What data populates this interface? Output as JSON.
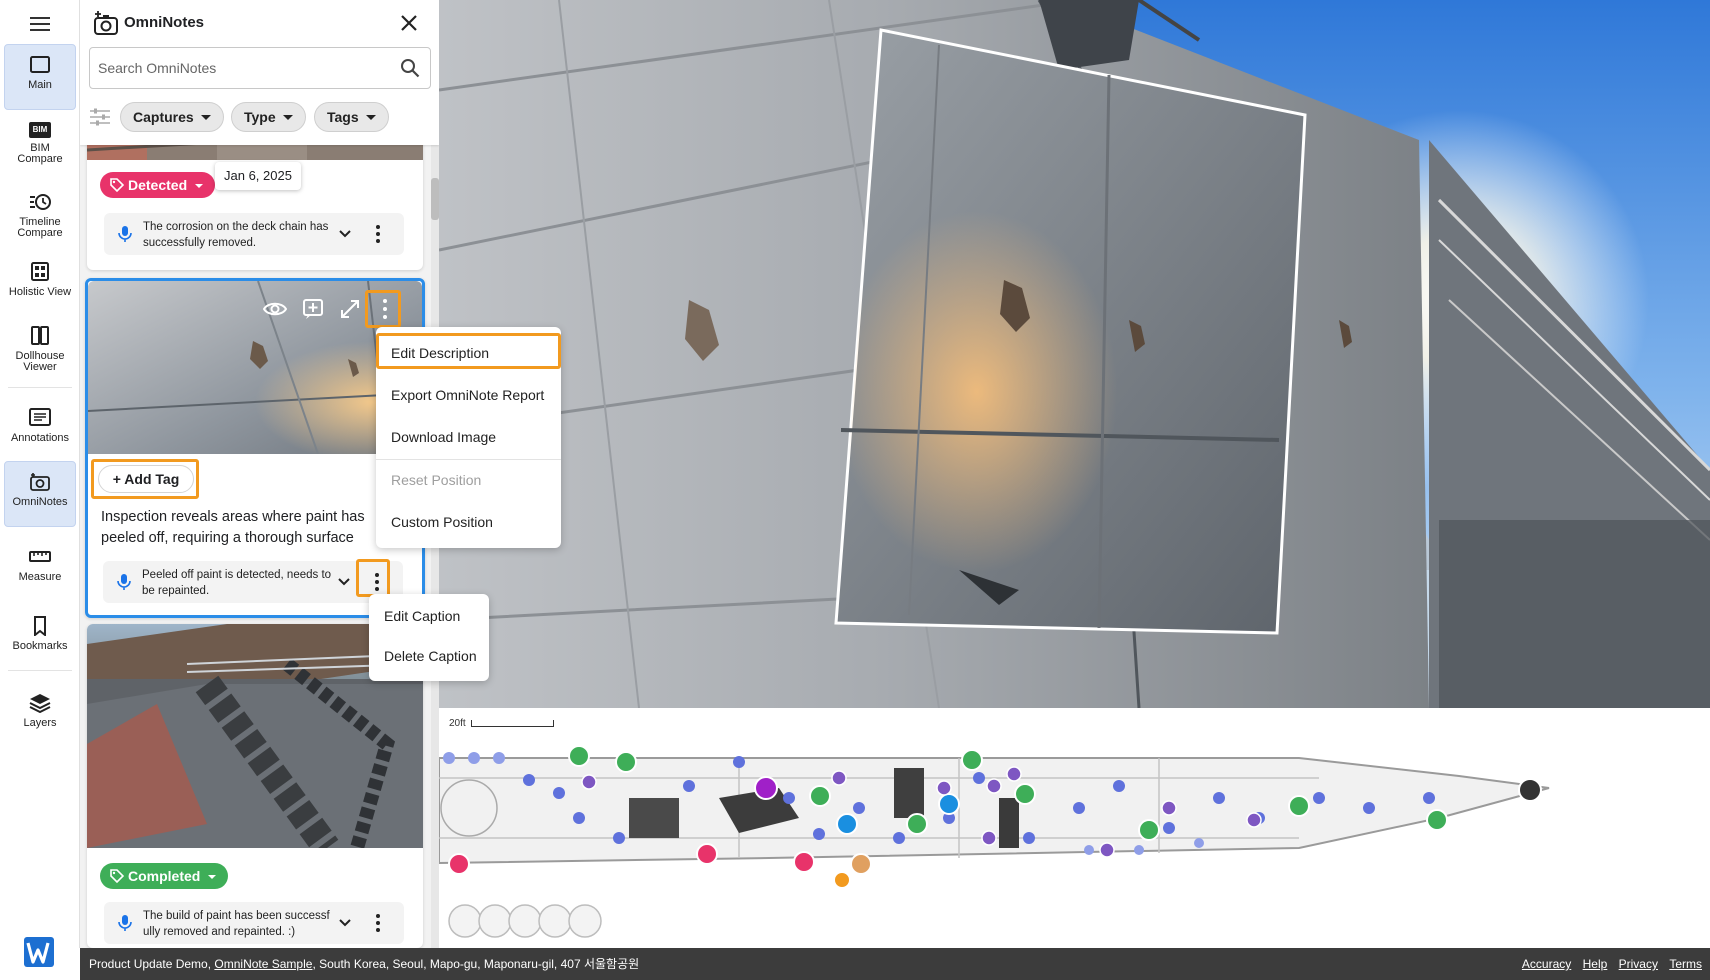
{
  "rail": {
    "items": [
      {
        "label": "Main"
      },
      {
        "label": "BIM\nCompare"
      },
      {
        "label": "Timeline\nCompare"
      },
      {
        "label": "Holistic View"
      },
      {
        "label": "Dollhouse\nViewer"
      },
      {
        "label": "Annotations"
      },
      {
        "label": "OmniNotes"
      },
      {
        "label": "Measure"
      },
      {
        "label": "Bookmarks"
      },
      {
        "label": "Layers"
      }
    ],
    "bim_badge": "BIM"
  },
  "panel": {
    "title": "OmniNotes",
    "search_placeholder": "Search OmniNotes",
    "filters": [
      {
        "label": "Captures"
      },
      {
        "label": "Type"
      },
      {
        "label": "Tags"
      }
    ]
  },
  "cards": [
    {
      "tag": "Detected",
      "tag_color": "#e8336a",
      "date_tooltip": "Jan 6, 2025",
      "caption": "The corrosion on the deck chain has successfully removed."
    },
    {
      "add_tag_label": "+  Add Tag",
      "description": "Inspection reveals areas where paint has peeled off, requiring a thorough surface preparation",
      "caption": "Peeled off paint is detected, needs to be repainted."
    },
    {
      "tag": "Completed",
      "tag_color": "#3eae58",
      "caption": "The build of paint has been successfully removed and repainted. :)"
    }
  ],
  "context_menu": {
    "items": [
      {
        "label": "Edit Description"
      },
      {
        "label": "Export OmniNote Report"
      },
      {
        "label": "Download Image"
      },
      {
        "label": "Reset Position",
        "disabled": true
      },
      {
        "label": "Custom Position"
      }
    ]
  },
  "caption_menu": {
    "items": [
      {
        "label": "Edit Caption"
      },
      {
        "label": "Delete Caption"
      }
    ]
  },
  "map": {
    "scale_label": "20ft"
  },
  "footer": {
    "prefix": "Product Update Demo, ",
    "link": "OmniNote Sample",
    "suffix": ", South Korea, Seoul, Mapo-gu, Maponaru-gil, 407 서울함공원",
    "links": [
      "Accuracy",
      "Help",
      "Privacy",
      "Terms"
    ]
  },
  "colors": {
    "accent": "#1a73e8",
    "highlight": "#f29a1f",
    "detected": "#e8336a",
    "completed": "#3eae58"
  }
}
